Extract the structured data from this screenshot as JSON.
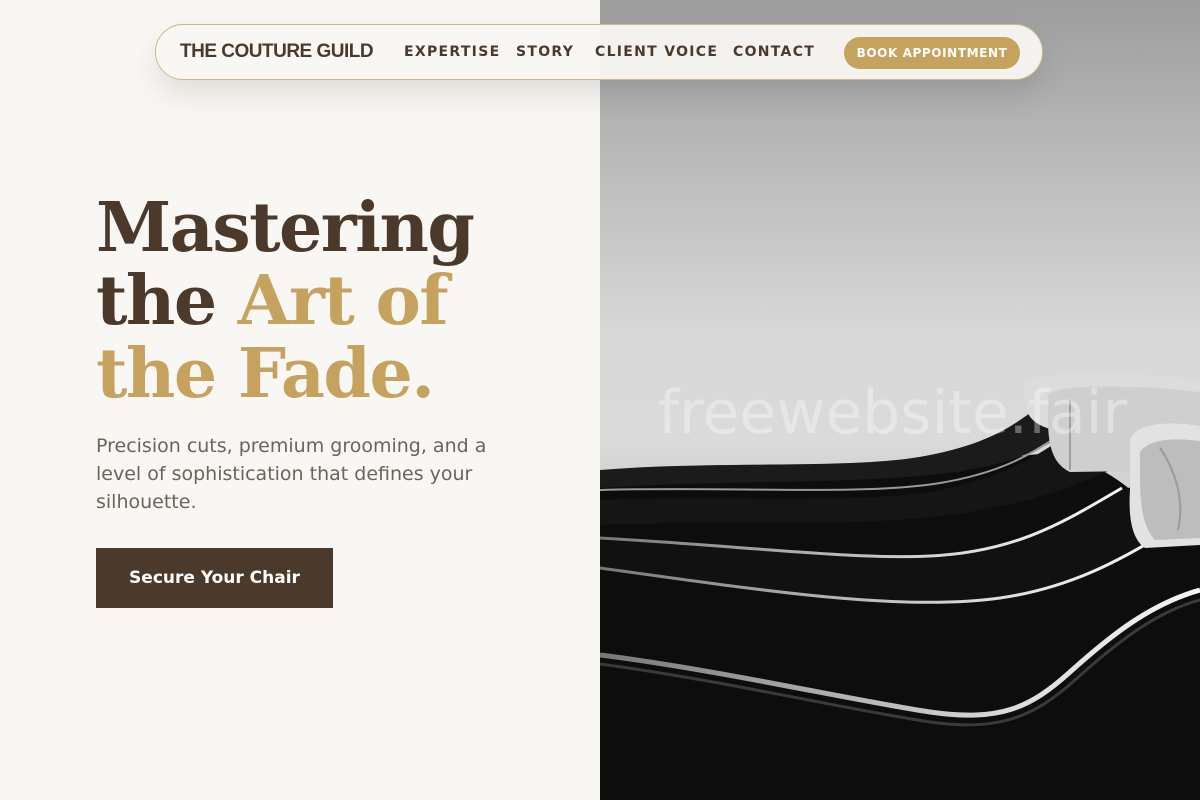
{
  "nav": {
    "brand": "THE COUTURE GUILD",
    "links": [
      "EXPERTISE",
      "STORY",
      "CLIENT VOICE",
      "CONTACT"
    ],
    "book_label": "BOOK APPOINTMENT"
  },
  "hero": {
    "title_line1": "Mastering",
    "title_line2_dark": "the ",
    "title_line2_gold": "Art of",
    "title_line3_gold": "the Fade.",
    "subtitle": "Precision cuts, premium grooming, and a level of sophistication that defines your silhouette.",
    "cta_label": "Secure Your Chair"
  },
  "watermark": "freewebsite.fair",
  "colors": {
    "brown": "#4b3a2b",
    "gold": "#c5a25e",
    "cream": "#f9f7f3"
  }
}
